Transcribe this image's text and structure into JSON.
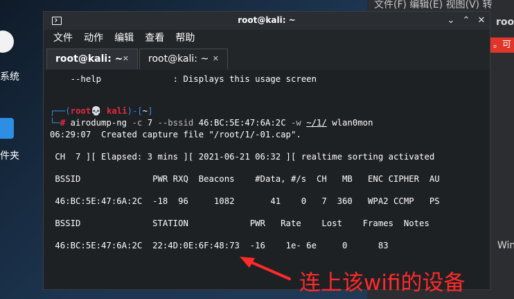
{
  "desktop": {
    "icon_labels": [
      "系统",
      "件夹"
    ]
  },
  "background_window": {
    "menu_text": "文件(F)  编辑(E)  视图(V)  转",
    "title": "root",
    "red_badge": "。可",
    "side_text": "Win"
  },
  "window": {
    "title": "root@kali: ~",
    "buttons": {
      "minimize": "⌄",
      "maximize": "⌃",
      "close": "✕"
    }
  },
  "menu": [
    "文件",
    "动作",
    "编辑",
    "查看",
    "帮助"
  ],
  "tabs": [
    {
      "label": "root@kali: ~",
      "close": "✕",
      "active": true
    },
    {
      "label": "root@kali: ~",
      "close": "✕",
      "active": false
    }
  ],
  "terminal": {
    "help_line": "    --help              : Displays this usage screen",
    "prompt_top_left": "┌──(",
    "prompt_user": "root💀 kali",
    "prompt_top_right": ")-[",
    "prompt_dir": "~",
    "prompt_top_end": "]",
    "prompt_bottom": "└─",
    "prompt_hash": "#",
    "command_name": "airodump-ng",
    "command_args_1": "-c",
    "command_channel": "7",
    "command_args_2": "--bssid",
    "command_bssid": "46:BC:5E:47:6A:2C",
    "command_args_3": "-w",
    "command_path": "~/1/",
    "command_iface": "wlan0mon",
    "capture_line": "06:29:07  Created capture file \"/root/1/-01.cap\".",
    "status_line": " CH  7 ][ Elapsed: 3 mins ][ 2021-06-21 06:32 ][ realtime sorting activated",
    "ap_header": " BSSID              PWR RXQ  Beacons    #Data, #/s  CH   MB   ENC CIPHER  AU",
    "ap_row": " 46:BC:5E:47:6A:2C  -18  96     1082       41    0   7  360   WPA2 CCMP   PS",
    "station_header": " BSSID              STATION            PWR   Rate    Lost    Frames  Notes",
    "station_row": " 46:BC:5E:47:6A:2C  22:4D:0E:6F:48:73  -16    1e- 6e     0      83"
  },
  "annotation": {
    "text": "连上该wifi的设备",
    "color": "#ff2a2a"
  },
  "colors": {
    "prompt_blue": "#2e8fe4",
    "prompt_red": "#e8293f",
    "terminal_bg": "#1e2124"
  }
}
